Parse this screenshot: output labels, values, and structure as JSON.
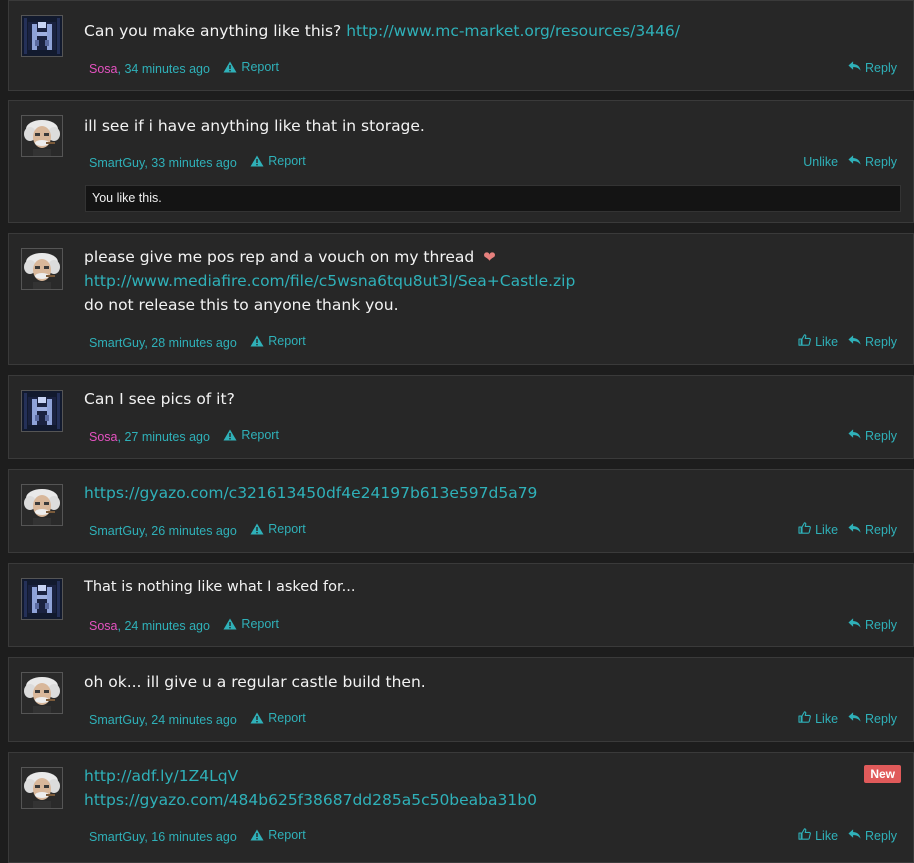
{
  "labels": {
    "report": "Report",
    "reply": "Reply",
    "like": "Like",
    "unlike": "Unlike",
    "you_like_this": "You like this.",
    "new_badge": "New"
  },
  "posts": [
    {
      "user": "Sosa",
      "time": "34 minutes ago",
      "lines": [
        [
          {
            "text": "Can you make anything like this? "
          },
          {
            "link": "http://www.mc-market.org/resources/3446/"
          }
        ]
      ]
    },
    {
      "user": "SmartGuy",
      "time": "33 minutes ago",
      "lines": [
        [
          {
            "text": "ill see if i have anything like that in storage."
          }
        ]
      ]
    },
    {
      "user": "SmartGuy",
      "time": "28 minutes ago",
      "lines": [
        [
          {
            "text": "please give me pos rep and a vouch on my thread "
          }
        ],
        [
          {
            "link": "http://www.mediafire.com/file/c5wsna6tqu8ut3l/Sea+Castle.zip"
          }
        ],
        [
          {
            "text": "do not release this to anyone thank you."
          }
        ]
      ]
    },
    {
      "user": "Sosa",
      "time": "27 minutes ago",
      "lines": [
        [
          {
            "text": "Can I see pics of it?"
          }
        ]
      ]
    },
    {
      "user": "SmartGuy",
      "time": "26 minutes ago",
      "lines": [
        [
          {
            "link": "https://gyazo.com/c321613450df4e24197b613e597d5a79"
          }
        ]
      ]
    },
    {
      "user": "Sosa",
      "time": "24 minutes ago",
      "lines": [
        [
          {
            "text": "That is nothing like what I asked for..."
          }
        ]
      ]
    },
    {
      "user": "SmartGuy",
      "time": "24 minutes ago",
      "lines": [
        [
          {
            "text": "oh ok... ill give u a regular castle build then."
          }
        ]
      ]
    },
    {
      "user": "SmartGuy",
      "time": "16 minutes ago",
      "lines": [
        [
          {
            "link": "http://adf.ly/1Z4LqV"
          }
        ],
        [
          {
            "link": "https://gyazo.com/484b625f38687dd285a5c50beaba31b0"
          }
        ]
      ]
    }
  ],
  "colors": {
    "link": "#2fb1b9",
    "sosa": "#e452c0",
    "badge": "#e05a5a",
    "heart": "#e6807d"
  }
}
